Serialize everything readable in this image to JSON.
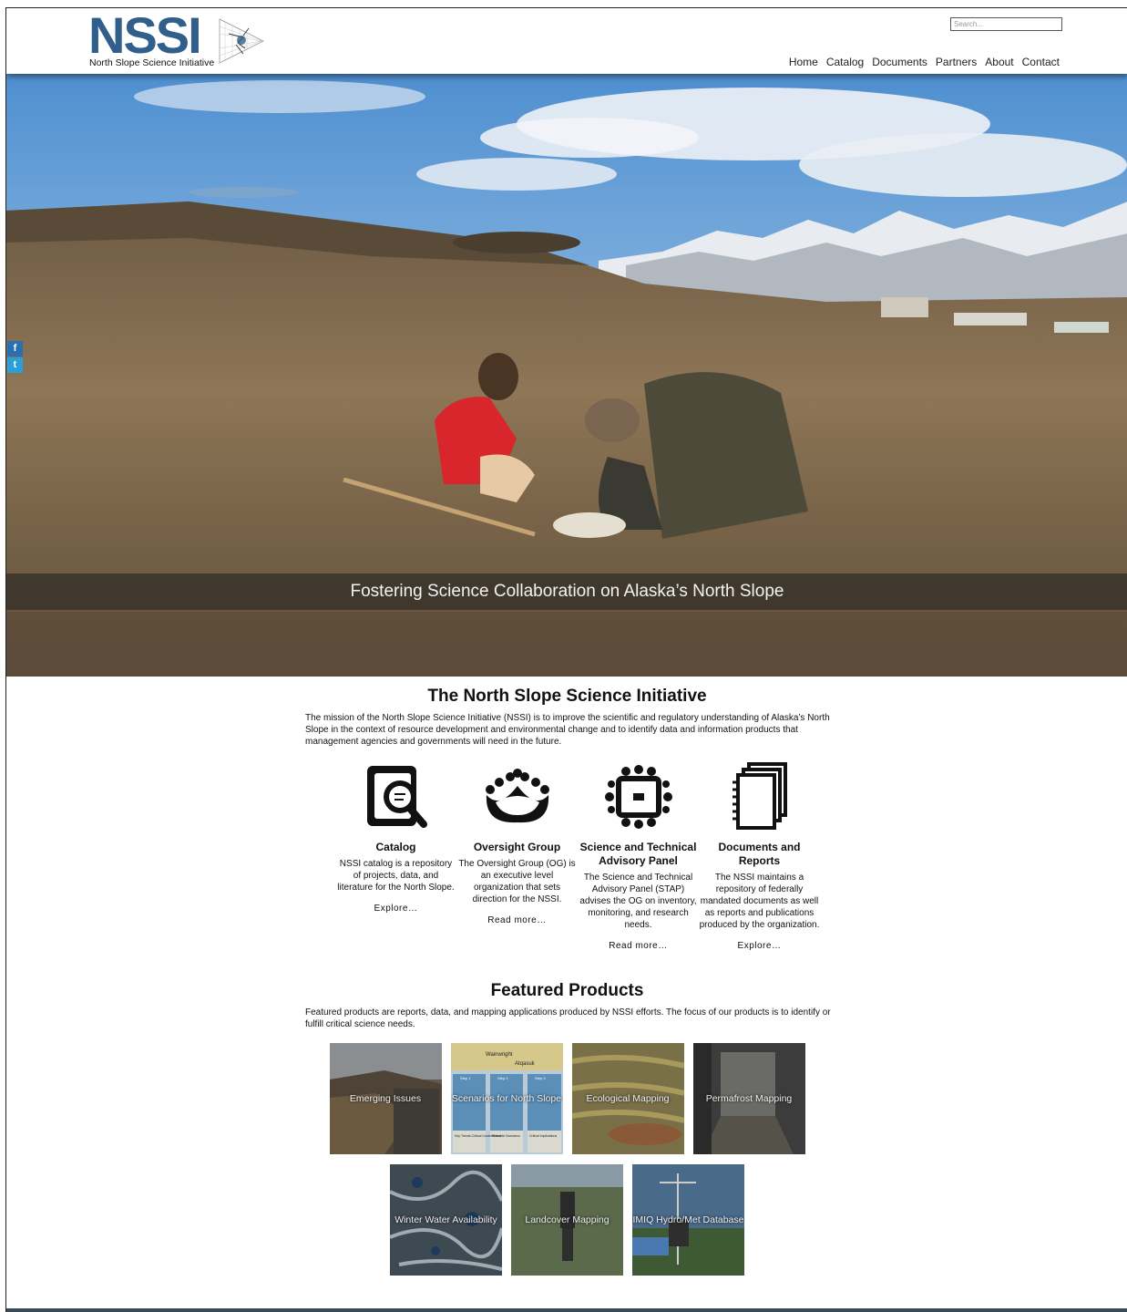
{
  "brand": {
    "word": "NSSI",
    "subtitle": "North Slope Science Initiative"
  },
  "search": {
    "placeholder": "Search..."
  },
  "nav": {
    "items": [
      "Home",
      "Catalog",
      "Documents",
      "Partners",
      "About",
      "Contact"
    ]
  },
  "social": {
    "facebook": "f",
    "twitter": "t"
  },
  "hero": {
    "caption": "Fostering Science Collaboration on Alaska’s North Slope"
  },
  "intro": {
    "title": "The North Slope Science Initiative",
    "text": "The mission of the North Slope Science Initiative (NSSI) is to improve the scientific and regulatory understanding of Alaska’s North Slope in the context of resource development and environmental change and to identify data and information products that management agencies and governments will need in the future."
  },
  "features": [
    {
      "title": "Catalog",
      "text": "NSSI catalog is a repository of projects, data, and literature for the North Slope.",
      "link": "Explore…",
      "icon": "catalog-search-icon"
    },
    {
      "title": "Oversight Group",
      "text": "The Oversight Group (OG) is an executive level organization that sets direction for the NSSI.",
      "link": "Read more…",
      "icon": "group-icon"
    },
    {
      "title": "Science and Technical Advisory Panel",
      "text": "The Science and Technical Advisory Panel (STAP) advises the OG on inventory, monitoring, and research needs.",
      "link": "Read more…",
      "icon": "meeting-table-icon"
    },
    {
      "title": "Documents and Reports",
      "text": "The NSSI maintains a repository of federally mandated documents as well as reports and publications produced by the organization.",
      "link": "Explore…",
      "icon": "documents-icon"
    }
  ],
  "featured": {
    "title": "Featured Products",
    "text": "Featured products are reports, data, and mapping applications produced by NSSI efforts. The focus of our products is to identify or fulfill critical science needs.",
    "row1": [
      "Emerging Issues",
      "Scenarios for North Slope",
      "Ecological Mapping",
      "Permafrost Mapping"
    ],
    "row2": [
      "Winter Water Availability",
      "Landcover Mapping",
      "IMIQ Hydro/Met Database"
    ],
    "scenario_labels": {
      "top1": "Wainwright",
      "top2": "Atqasuk",
      "step1": "Step 1",
      "step2": "Step 2",
      "step3": "Step 3",
      "b1": "Key Trends Critical Uncertainties",
      "b2": "Plausible Scenarios",
      "b3": "Critical Implications"
    }
  }
}
